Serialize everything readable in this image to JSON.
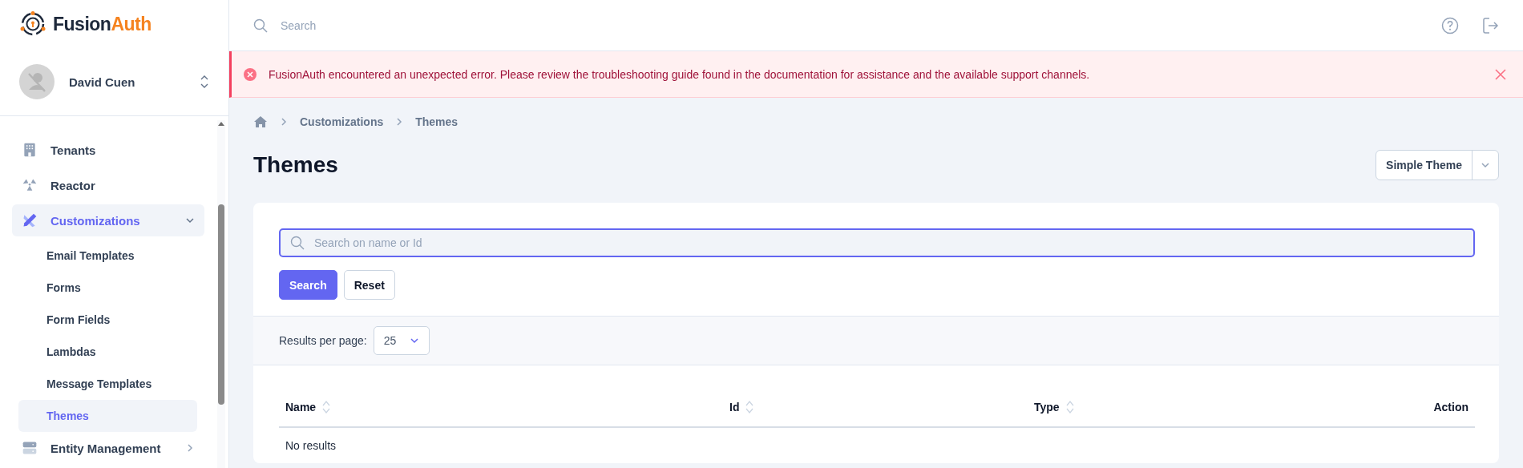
{
  "brand": {
    "name_first": "Fusion",
    "name_second": "Auth"
  },
  "user": {
    "name": "David Cuen"
  },
  "sidebar": {
    "items": [
      {
        "label": "Tenants",
        "selected": false
      },
      {
        "label": "Reactor",
        "selected": false
      },
      {
        "label": "Customizations",
        "expanded": true,
        "selected": true,
        "children": [
          {
            "label": "Email Templates",
            "selected": false
          },
          {
            "label": "Forms",
            "selected": false
          },
          {
            "label": "Form Fields",
            "selected": false
          },
          {
            "label": "Lambdas",
            "selected": false
          },
          {
            "label": "Message Templates",
            "selected": false
          },
          {
            "label": "Themes",
            "selected": true
          }
        ]
      },
      {
        "label": "Entity Management",
        "expanded": false,
        "selected": false
      }
    ]
  },
  "topbar": {
    "search": {
      "placeholder": "Search"
    }
  },
  "alert": {
    "message": "FusionAuth encountered an unexpected error. Please review the troubleshooting guide found in the documentation for assistance and the available support channels."
  },
  "breadcrumb": [
    "Customizations",
    "Themes"
  ],
  "page_title": "Themes",
  "theme_select": {
    "value": "Simple Theme"
  },
  "search_form": {
    "placeholder": "Search on name or Id",
    "buttons": [
      {
        "label": "Search",
        "kind": "primary"
      },
      {
        "label": "Reset",
        "kind": "secondary"
      }
    ]
  },
  "pagination": {
    "label": "Results per page:",
    "value": "25"
  },
  "table": {
    "columns": [
      {
        "label": "Name",
        "sortable": true
      },
      {
        "label": "Id",
        "sortable": true
      },
      {
        "label": "Type",
        "sortable": true
      },
      {
        "label": "Action",
        "sortable": false
      }
    ],
    "empty_message": "No results"
  }
}
